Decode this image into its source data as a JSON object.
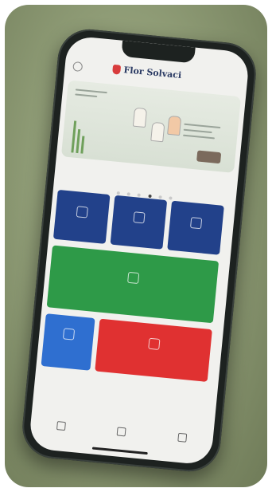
{
  "app": {
    "logo_text": "Flor Solvaci"
  },
  "colors": {
    "tile_blue": "#22418a",
    "tile_green": "#2e9a48",
    "tile_red": "#e03131",
    "tile_light_blue": "#2f6fd0",
    "background": "#8f9c76"
  },
  "icons": {
    "back": "back-icon",
    "logo": "logo-icon"
  }
}
